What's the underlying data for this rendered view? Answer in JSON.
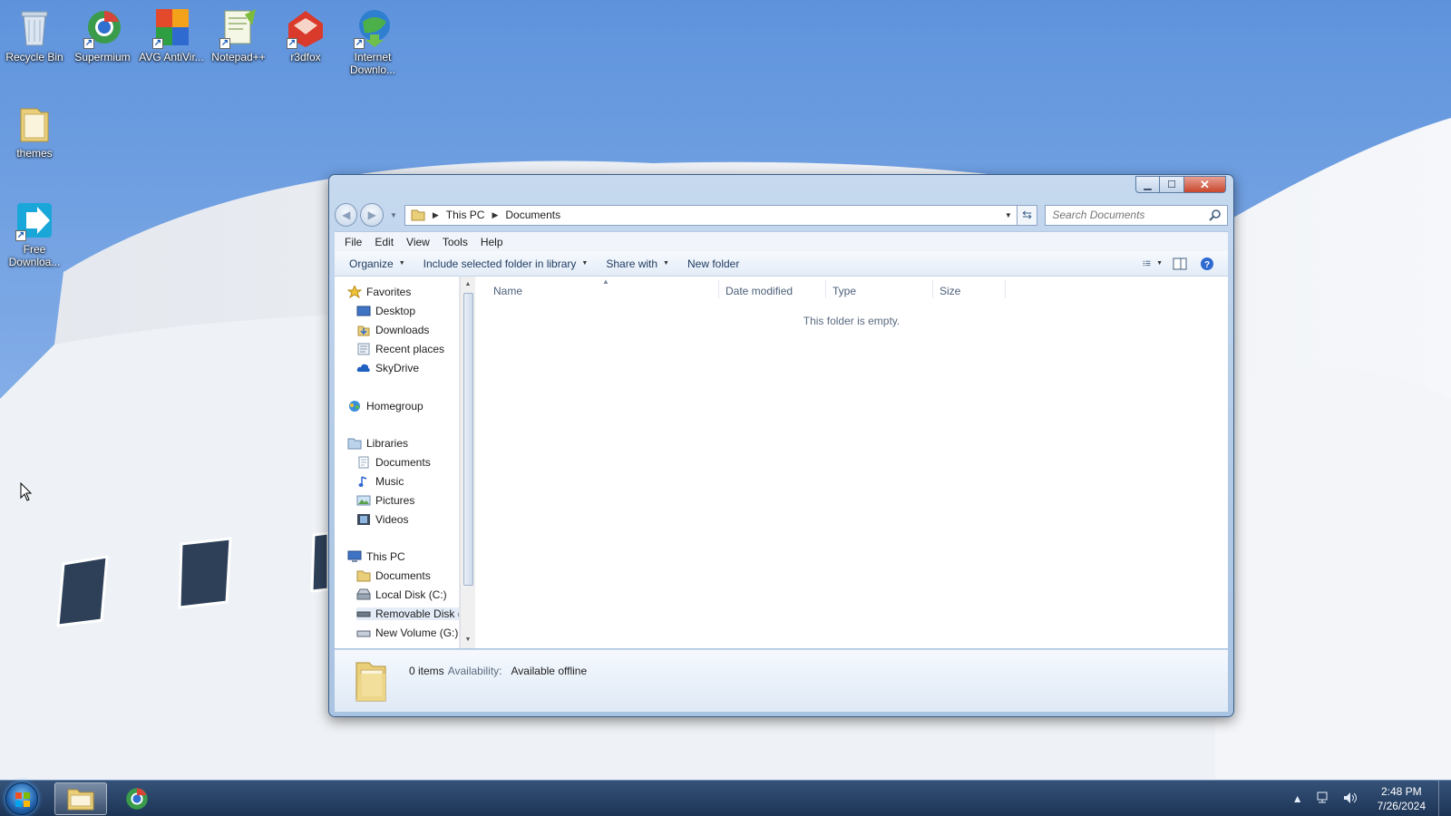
{
  "desktop": {
    "icons": [
      {
        "label": "Recycle Bin",
        "icon": "recycle-bin-icon"
      },
      {
        "label": "Supermium",
        "icon": "browser-icon"
      },
      {
        "label": "AVG AntiVir...",
        "icon": "antivirus-icon"
      },
      {
        "label": "Notepad++",
        "icon": "notepad-icon"
      },
      {
        "label": "r3dfox",
        "icon": "r3dfox-icon"
      },
      {
        "label": "Internet Downlo...",
        "icon": "download-manager-icon"
      },
      {
        "label": "themes",
        "icon": "folder-icon"
      },
      {
        "label": "Free Downloa...",
        "icon": "free-download-icon"
      }
    ]
  },
  "window": {
    "address": {
      "root": "This PC",
      "current": "Documents"
    },
    "search_placeholder": "Search Documents",
    "menu": [
      "File",
      "Edit",
      "View",
      "Tools",
      "Help"
    ],
    "toolbar": {
      "organize": "Organize",
      "include": "Include selected folder in library",
      "share": "Share with",
      "new_folder": "New folder"
    },
    "nav": {
      "favorites": "Favorites",
      "desktop": "Desktop",
      "downloads": "Downloads",
      "recent": "Recent places",
      "skydrive": "SkyDrive",
      "homegroup": "Homegroup",
      "libraries": "Libraries",
      "lib_documents": "Documents",
      "music": "Music",
      "pictures": "Pictures",
      "videos": "Videos",
      "thispc": "This PC",
      "pc_documents": "Documents",
      "local_disk": "Local Disk (C:)",
      "removable": "Removable Disk (",
      "new_volume": "New Volume (G:)"
    },
    "columns": {
      "name": "Name",
      "date": "Date modified",
      "type": "Type",
      "size": "Size"
    },
    "empty_message": "This folder is empty.",
    "details": {
      "items": "0 items",
      "availability_label": "Availability:",
      "availability_value": "Available offline"
    }
  },
  "taskbar": {
    "time": "2:48 PM",
    "date": "7/26/2024"
  },
  "colors": {
    "accent": "#3a5f8a",
    "taskbar": "#1f3b63"
  }
}
